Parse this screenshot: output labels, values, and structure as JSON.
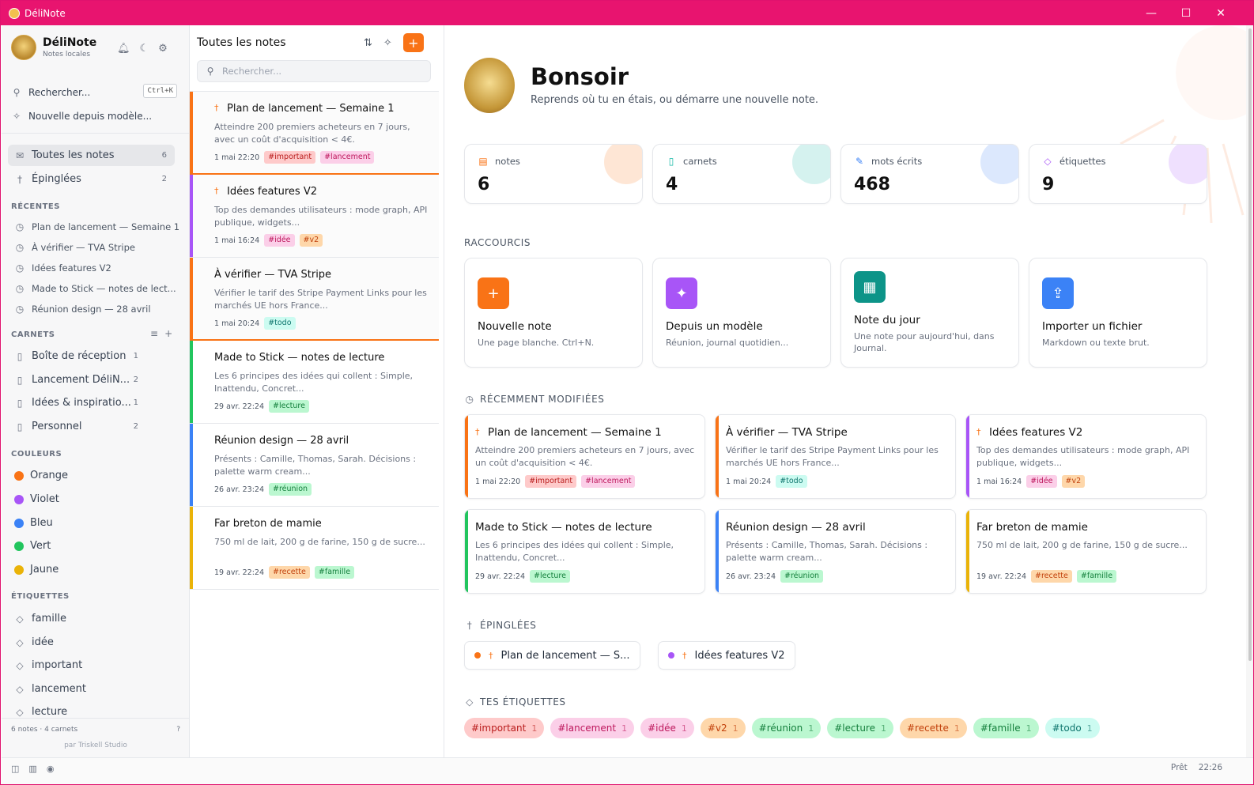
{
  "window": {
    "title": "DéliNote",
    "controls": [
      "—",
      "☐",
      "✕"
    ]
  },
  "sidebar": {
    "brand": {
      "name": "DéliNote",
      "subtitle": "Notes locales"
    },
    "search": {
      "label": "Rechercher...",
      "shortcut": "Ctrl+K"
    },
    "template_label": "Nouvelle depuis modèle...",
    "nav": [
      {
        "label": "Toutes les notes",
        "count": "6"
      },
      {
        "label": "Épinglées",
        "count": "2"
      }
    ],
    "recent_title": "RÉCENTES",
    "recent": [
      "Plan de lancement — Semaine 1",
      "À vérifier — TVA Stripe",
      "Idées features V2",
      "Made to Stick — notes de lect...",
      "Réunion design — 28 avril"
    ],
    "notebooks_title": "CARNETS",
    "notebooks": [
      {
        "label": "Boîte de réception",
        "count": "1"
      },
      {
        "label": "Lancement DéliN...",
        "count": "2"
      },
      {
        "label": "Idées & inspiratio...",
        "count": "1"
      },
      {
        "label": "Personnel",
        "count": "2"
      }
    ],
    "colors_title": "COULEURS",
    "colors": [
      {
        "label": "Orange",
        "hex": "#f97316"
      },
      {
        "label": "Violet",
        "hex": "#a855f7"
      },
      {
        "label": "Bleu",
        "hex": "#3b82f6"
      },
      {
        "label": "Vert",
        "hex": "#22c55e"
      },
      {
        "label": "Jaune",
        "hex": "#eab308"
      }
    ],
    "tags_title": "ÉTIQUETTES",
    "tags": [
      "famille",
      "idée",
      "important",
      "lancement",
      "lecture"
    ],
    "footer": "6 notes · 4 carnets",
    "help": "?",
    "credit": "par Triskell Studio"
  },
  "list": {
    "title": "Toutes les notes",
    "search_placeholder": "Rechercher...",
    "notes": [
      {
        "title": "Plan de lancement — Semaine 1",
        "pinned": true,
        "color": "#f97316",
        "excerpt": "Atteindre 200 premiers acheteurs en 7 jours, avec un coût d'acquisition < 4€.",
        "date": "1 mai 22:20",
        "tags": [
          "#important",
          "#lancement"
        ]
      },
      {
        "title": "Idées features V2",
        "pinned": true,
        "color": "#a855f7",
        "excerpt": "Top des demandes utilisateurs : mode graph, API publique, widgets...",
        "date": "1 mai 16:24",
        "tags": [
          "#idée",
          "#v2"
        ]
      },
      {
        "title": "À vérifier — TVA Stripe",
        "pinned": false,
        "color": "#f97316",
        "excerpt": "Vérifier le tarif des Stripe Payment Links pour les marchés UE hors France...",
        "date": "1 mai 20:24",
        "tags": [
          "#todo"
        ]
      },
      {
        "title": "Made to Stick — notes de lecture",
        "pinned": false,
        "color": "#22c55e",
        "excerpt": "Les 6 principes des idées qui collent : Simple, Inattendu, Concret...",
        "date": "29 avr. 22:24",
        "tags": [
          "#lecture"
        ]
      },
      {
        "title": "Réunion design — 28 avril",
        "pinned": false,
        "color": "#3b82f6",
        "excerpt": "Présents : Camille, Thomas, Sarah. Décisions : palette warm cream...",
        "date": "26 avr. 23:24",
        "tags": [
          "#réunion"
        ]
      },
      {
        "title": "Far breton de mamie",
        "pinned": false,
        "color": "#eab308",
        "excerpt": "750 ml de lait, 200 g de farine, 150 g de sucre...",
        "date": "19 avr. 22:24",
        "tags": [
          "#recette",
          "#famille"
        ]
      }
    ]
  },
  "tag_styles": {
    "#important": {
      "bg": "#fecaca",
      "fg": "#b91c1c"
    },
    "#lancement": {
      "bg": "#fbcfe8",
      "fg": "#be185d"
    },
    "#idée": {
      "bg": "#fbcfe8",
      "fg": "#be185d"
    },
    "#v2": {
      "bg": "#fed7aa",
      "fg": "#c2410c"
    },
    "#todo": {
      "bg": "#ccfbf1",
      "fg": "#0f766e"
    },
    "#lecture": {
      "bg": "#bbf7d0",
      "fg": "#15803d"
    },
    "#réunion": {
      "bg": "#bbf7d0",
      "fg": "#15803d"
    },
    "#recette": {
      "bg": "#fed7aa",
      "fg": "#c2410c"
    },
    "#famille": {
      "bg": "#bbf7d0",
      "fg": "#15803d"
    }
  },
  "main": {
    "greeting": "Bonsoir",
    "subtitle": "Reprends où tu en étais, ou démarre une nouvelle note.",
    "stats": [
      {
        "label": "notes",
        "value": "6",
        "icon": "file-icon",
        "color": "#f97316"
      },
      {
        "label": "carnets",
        "value": "4",
        "icon": "notebook-icon",
        "color": "#14b8a6"
      },
      {
        "label": "mots écrits",
        "value": "468",
        "icon": "doc-edit-icon",
        "color": "#3b82f6"
      },
      {
        "label": "étiquettes",
        "value": "9",
        "icon": "tag-icon",
        "color": "#a855f7"
      }
    ],
    "shortcuts_title": "RACCOURCIS",
    "shortcuts": [
      {
        "title": "Nouvelle note",
        "desc": "Une page blanche. Ctrl+N.",
        "color": "#f97316",
        "glyph": "+"
      },
      {
        "title": "Depuis un modèle",
        "desc": "Réunion, journal quotidien...",
        "color": "#a855f7",
        "glyph": "✦"
      },
      {
        "title": "Note du jour",
        "desc": "Une note pour aujourd'hui, dans Journal.",
        "color": "#0d9488",
        "glyph": "▦"
      },
      {
        "title": "Importer un fichier",
        "desc": "Markdown ou texte brut.",
        "color": "#3b82f6",
        "glyph": "⇪"
      }
    ],
    "recent_title": "RÉCEMMENT MODIFIÉES",
    "recent": [
      {
        "title": "Plan de lancement — Semaine 1",
        "pinned": true,
        "color": "#f97316",
        "excerpt": "Atteindre 200 premiers acheteurs en 7 jours, avec un coût d'acquisition < 4€.",
        "date": "1 mai 22:20",
        "tags": [
          "#important",
          "#lancement"
        ]
      },
      {
        "title": "À vérifier — TVA Stripe",
        "pinned": false,
        "color": "#f97316",
        "excerpt": "Vérifier le tarif des Stripe Payment Links pour les marchés UE hors France...",
        "date": "1 mai 20:24",
        "tags": [
          "#todo"
        ]
      },
      {
        "title": "Idées features V2",
        "pinned": true,
        "color": "#a855f7",
        "excerpt": "Top des demandes utilisateurs : mode graph, API publique, widgets...",
        "date": "1 mai 16:24",
        "tags": [
          "#idée",
          "#v2"
        ]
      },
      {
        "title": "Made to Stick — notes de lecture",
        "pinned": false,
        "color": "#22c55e",
        "excerpt": "Les 6 principes des idées qui collent : Simple, Inattendu, Concret...",
        "date": "29 avr. 22:24",
        "tags": [
          "#lecture"
        ]
      },
      {
        "title": "Réunion design — 28 avril",
        "pinned": false,
        "color": "#3b82f6",
        "excerpt": "Présents : Camille, Thomas, Sarah. Décisions : palette warm cream...",
        "date": "26 avr. 23:24",
        "tags": [
          "#réunion"
        ]
      },
      {
        "title": "Far breton de mamie",
        "pinned": false,
        "color": "#eab308",
        "excerpt": "750 ml de lait, 200 g de farine, 150 g de sucre...",
        "date": "19 avr. 22:24",
        "tags": [
          "#recette",
          "#famille"
        ]
      }
    ],
    "pinned_title": "ÉPINGLÉES",
    "pinned": [
      {
        "title": "Plan de lancement — S...",
        "color": "#f97316"
      },
      {
        "title": "Idées features V2",
        "color": "#a855f7"
      }
    ],
    "tags_title": "TES ÉTIQUETTES",
    "tags": [
      {
        "label": "#important",
        "count": "1"
      },
      {
        "label": "#lancement",
        "count": "1"
      },
      {
        "label": "#idée",
        "count": "1"
      },
      {
        "label": "#v2",
        "count": "1"
      },
      {
        "label": "#réunion",
        "count": "1"
      },
      {
        "label": "#lecture",
        "count": "1"
      },
      {
        "label": "#recette",
        "count": "1"
      },
      {
        "label": "#famille",
        "count": "1"
      },
      {
        "label": "#todo",
        "count": "1"
      }
    ]
  },
  "status": {
    "state": "Prêt",
    "time": "22:26"
  }
}
